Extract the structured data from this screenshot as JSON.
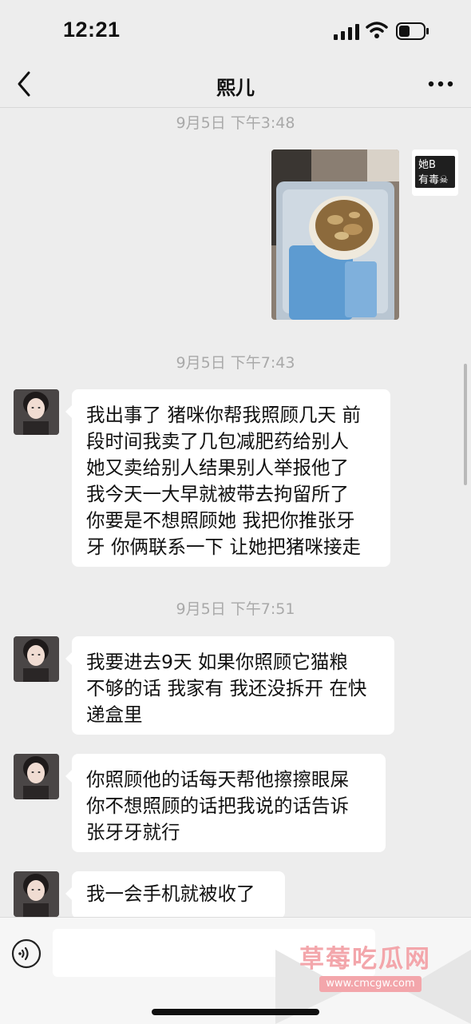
{
  "status_bar": {
    "time": "12:21"
  },
  "header": {
    "title": "熙儿"
  },
  "messages": {
    "ts1": "9月5日 下午3:48",
    "sender_tag": {
      "line1": "她B",
      "line2": "有毒☠"
    },
    "ts2": "9月5日 下午7:43",
    "m1": [
      "我出事了 猪咪你帮我照顾几天 前",
      "段时间我卖了几包减肥药给别人",
      "她又卖给别人结果别人举报他了",
      "我今天一大早就被带去拘留所了",
      "你要是不想照顾她 我把你推张牙",
      "牙 你俩联系一下 让她把猪咪接走"
    ],
    "ts3": "9月5日 下午7:51",
    "m2": [
      "我要进去9天 如果你照顾它猫粮",
      "不够的话 我家有 我还没拆开 在快",
      "递盒里"
    ],
    "m3": [
      "你照顾他的话每天帮他擦擦眼屎",
      "你不想照顾的话把我说的话告诉",
      "张牙牙就行"
    ],
    "m4": [
      "我一会手机就被收了"
    ]
  },
  "watermark": {
    "text": "草莓吃瓜网",
    "url": "www.cmcgw.com"
  }
}
